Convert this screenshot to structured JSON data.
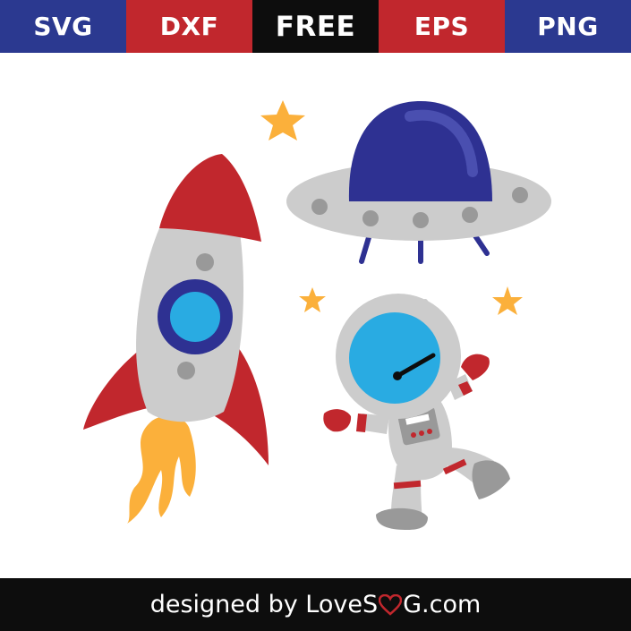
{
  "tabs": [
    {
      "label": "SVG",
      "color": "#2b3990"
    },
    {
      "label": "DXF",
      "color": "#c1272d"
    },
    {
      "label": "FREE",
      "color": "#0d0d0d"
    },
    {
      "label": "EPS",
      "color": "#c1272d"
    },
    {
      "label": "PNG",
      "color": "#2b3990"
    }
  ],
  "artwork": {
    "items": [
      "rocket",
      "ufo",
      "astronaut",
      "star",
      "star",
      "star"
    ],
    "colors": {
      "red": "#c1272d",
      "blue": "#2e3192",
      "light_blue": "#29abe2",
      "gray": "#cccccc",
      "dark_gray": "#999999",
      "yellow": "#fbb03b",
      "navy": "#2e3192"
    }
  },
  "footer": {
    "prefix": "designed by LoveS",
    "heart_icon": "heart-icon",
    "suffix": "G.com",
    "heart_color": "#c1272d"
  }
}
